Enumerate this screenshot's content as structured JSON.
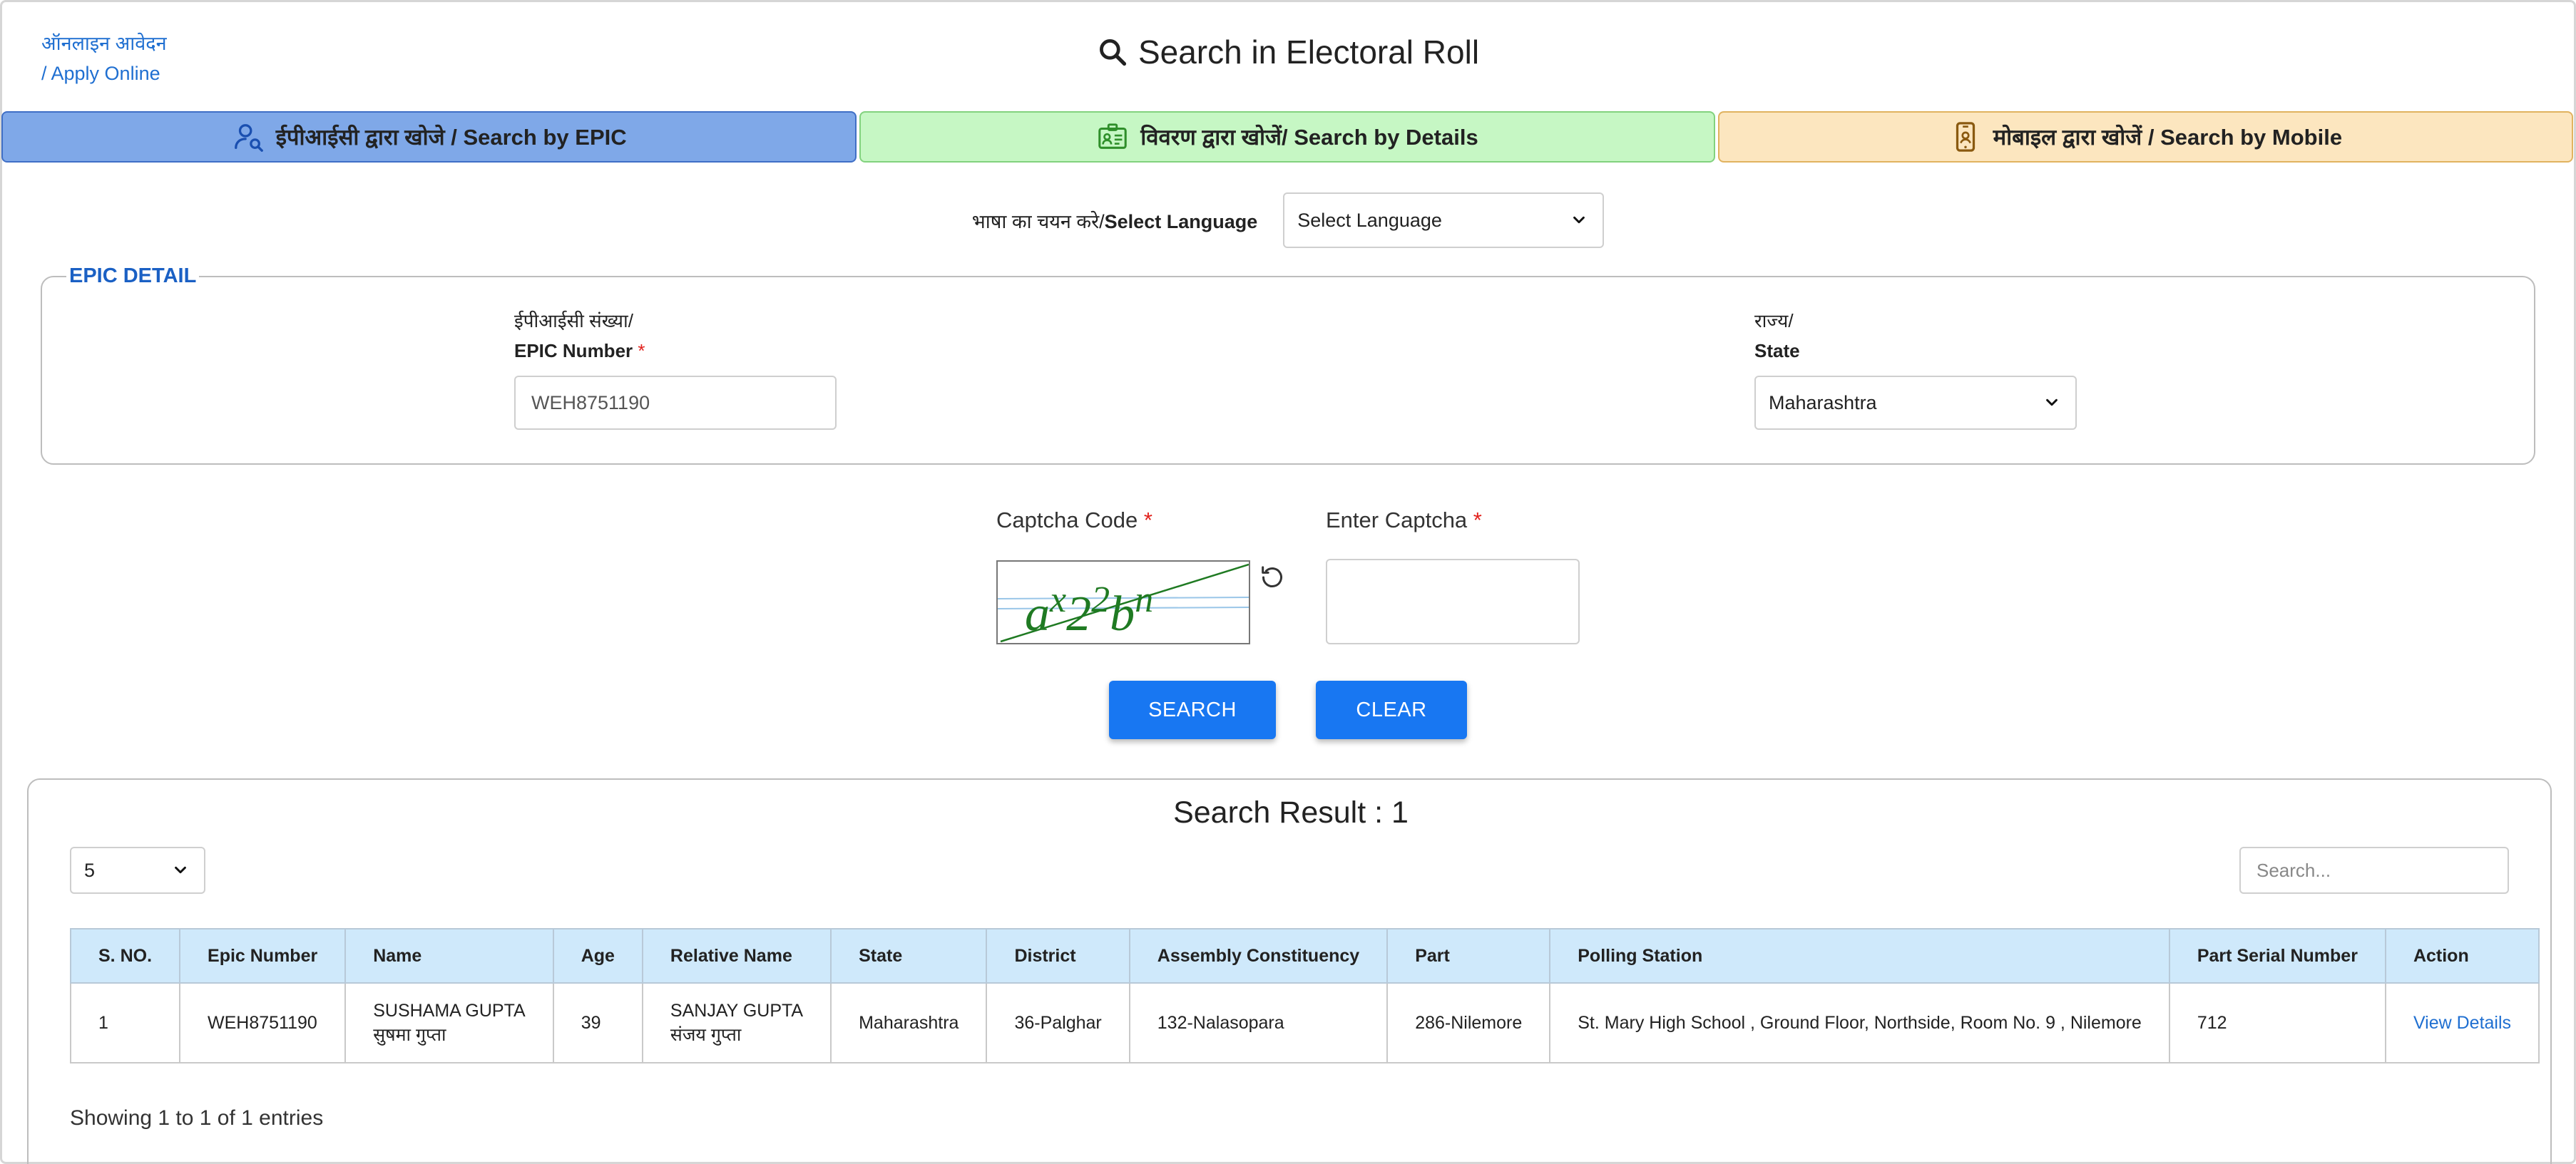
{
  "header": {
    "apply_online_hi": "ऑनलाइन आवेदन",
    "apply_online_en": "/ Apply Online",
    "title": "Search in Electoral Roll",
    "title_icon": "search-icon"
  },
  "tabs": [
    {
      "label": "ईपीआईसी द्वारा खोजे / Search by EPIC",
      "icon": "user-search-icon",
      "active": true
    },
    {
      "label": "विवरण द्वारा खोजें/ Search by Details",
      "icon": "id-card-icon",
      "active": false
    },
    {
      "label": "मोबाइल द्वारा खोजें / Search by Mobile",
      "icon": "mobile-phone-icon",
      "active": false
    }
  ],
  "language": {
    "label_hi": "भाषा का चयन करे/",
    "label_en": "Select Language",
    "selected": "Select Language"
  },
  "epic_detail": {
    "legend": "EPIC DETAIL",
    "epic_label_hi": "ईपीआईसी संख्या/",
    "epic_label_en": "EPIC Number",
    "epic_value": "WEH8751190",
    "state_label_hi": "राज्य/",
    "state_label_en": "State",
    "state_value": "Maharashtra",
    "required_mark": "*"
  },
  "captcha": {
    "code_label": "Captcha Code",
    "enter_label": "Enter Captcha",
    "required_mark": "*",
    "image_text": "ax22bn",
    "input_value": ""
  },
  "buttons": {
    "search": "SEARCH",
    "clear": "CLEAR"
  },
  "results": {
    "title": "Search Result : 1",
    "page_size": "5",
    "search_placeholder": "Search...",
    "columns": [
      "S. NO.",
      "Epic Number",
      "Name",
      "Age",
      "Relative Name",
      "State",
      "District",
      "Assembly Constituency",
      "Part",
      "Polling Station",
      "Part Serial Number",
      "Action"
    ],
    "rows": [
      {
        "sno": "1",
        "epic": "WEH8751190",
        "name_en": "SUSHAMA GUPTA",
        "name_hi": "सुषमा गुप्ता",
        "age": "39",
        "relative_en": "SANJAY GUPTA",
        "relative_hi": "संजय गुप्ता",
        "state": "Maharashtra",
        "district": "36-Palghar",
        "assembly": "132-Nalasopara",
        "part": "286-Nilemore",
        "polling_station": "St. Mary High School , Ground Floor, Northside, Room No. 9 , Nilemore",
        "part_serial": "712",
        "action": "View Details"
      }
    ],
    "showing": "Showing 1 to 1 of 1 entries"
  },
  "colors": {
    "primary_button": "#1877f2",
    "tab_epic": "#7fa8e8",
    "tab_details": "#c6f7c4",
    "tab_mobile": "#fce6bf",
    "link": "#1f6fd1",
    "legend": "#1a60c4",
    "required": "#e2211c"
  }
}
